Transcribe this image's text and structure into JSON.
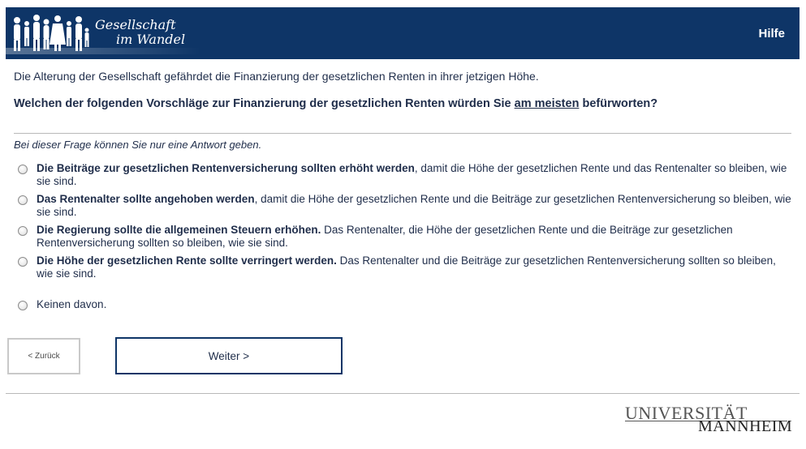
{
  "header": {
    "logo_line1": "Gesellschaft",
    "logo_line2": "im Wandel",
    "help_label": "Hilfe"
  },
  "intro": "Die Alterung der Gesellschaft gefährdet die Finanzierung der gesetzlichen Renten in ihrer jetzigen Höhe.",
  "question": {
    "before": "Welchen der folgenden Vorschläge zur Finanzierung der gesetzlichen Renten würden Sie ",
    "emphasis": "am meisten",
    "after": " befürworten?"
  },
  "hint": "Bei dieser Frage können Sie nur eine Antwort geben.",
  "options": [
    {
      "bold": "Die Beiträge zur gesetzlichen Rentenversicherung sollten erhöht werden",
      "rest": ", damit die Höhe der gesetzlichen Rente und das Rentenalter so bleiben, wie sie sind."
    },
    {
      "bold": "Das Rentenalter sollte angehoben werden",
      "rest": ", damit die Höhe der gesetzlichen Rente und die Beiträge zur gesetzlichen Rentenversicherung so bleiben, wie sie sind."
    },
    {
      "bold": "Die Regierung sollte die allgemeinen Steuern erhöhen.",
      "rest": " Das Rentenalter, die Höhe der gesetzlichen Rente und die Beiträge zur gesetzlichen Rentenversicherung sollten so bleiben, wie sie sind."
    },
    {
      "bold": "Die Höhe der gesetzlichen Rente sollte verringert werden.",
      "rest": " Das Rentenalter und die Beiträge zur gesetzlichen Rentenversicherung sollten so bleiben, wie sie sind."
    },
    {
      "bold": "",
      "rest": "Keinen davon."
    }
  ],
  "buttons": {
    "back_label": "< Zurück",
    "next_label": "Weiter >"
  },
  "footer": {
    "university_line1": "UNIVERSITÄT",
    "university_line2": "MANNHEIM"
  },
  "colors": {
    "brand": "#0e3567",
    "text": "#1f2d4a"
  }
}
